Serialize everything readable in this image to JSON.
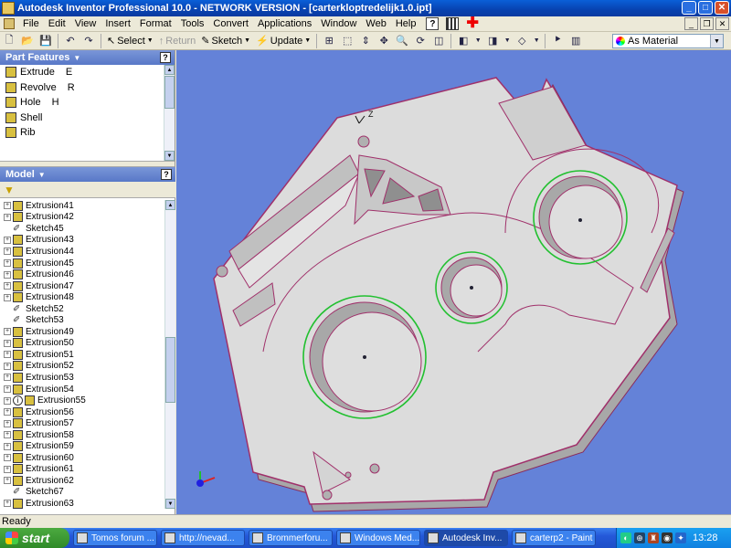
{
  "window": {
    "title": "Autodesk Inventor Professional 10.0 - NETWORK VERSION - [carterkloptredelijk1.0.ipt]",
    "controls": [
      "_",
      "□",
      "✕"
    ]
  },
  "menu": {
    "items": [
      "File",
      "Edit",
      "View",
      "Insert",
      "Format",
      "Tools",
      "Convert",
      "Applications",
      "Window",
      "Web",
      "Help"
    ],
    "mdi_controls": [
      "_",
      "❐",
      "✕"
    ]
  },
  "toolbar": {
    "select_label": "Select",
    "return_label": "Return",
    "sketch_label": "Sketch",
    "update_label": "Update",
    "material_value": "As Material"
  },
  "part_features": {
    "title": "Part Features",
    "help": "?",
    "items": [
      {
        "label": "Extrude",
        "key": "E"
      },
      {
        "label": "Revolve",
        "key": "R"
      },
      {
        "label": "Hole",
        "key": "H"
      },
      {
        "label": "Shell",
        "key": ""
      },
      {
        "label": "Rib",
        "key": ""
      }
    ]
  },
  "model": {
    "title": "Model",
    "help": "?",
    "tree": [
      {
        "label": "Extrusion41",
        "type": "extrusion"
      },
      {
        "label": "Extrusion42",
        "type": "extrusion"
      },
      {
        "label": "Sketch45",
        "type": "sketch"
      },
      {
        "label": "Extrusion43",
        "type": "extrusion"
      },
      {
        "label": "Extrusion44",
        "type": "extrusion"
      },
      {
        "label": "Extrusion45",
        "type": "extrusion"
      },
      {
        "label": "Extrusion46",
        "type": "extrusion"
      },
      {
        "label": "Extrusion47",
        "type": "extrusion"
      },
      {
        "label": "Extrusion48",
        "type": "extrusion"
      },
      {
        "label": "Sketch52",
        "type": "sketch"
      },
      {
        "label": "Sketch53",
        "type": "sketch"
      },
      {
        "label": "Extrusion49",
        "type": "extrusion"
      },
      {
        "label": "Extrusion50",
        "type": "extrusion"
      },
      {
        "label": "Extrusion51",
        "type": "extrusion"
      },
      {
        "label": "Extrusion52",
        "type": "extrusion"
      },
      {
        "label": "Extrusion53",
        "type": "extrusion"
      },
      {
        "label": "Extrusion54",
        "type": "extrusion"
      },
      {
        "label": "Extrusion55",
        "type": "info"
      },
      {
        "label": "Extrusion56",
        "type": "extrusion"
      },
      {
        "label": "Extrusion57",
        "type": "extrusion"
      },
      {
        "label": "Extrusion58",
        "type": "extrusion"
      },
      {
        "label": "Extrusion59",
        "type": "extrusion"
      },
      {
        "label": "Extrusion60",
        "type": "extrusion"
      },
      {
        "label": "Extrusion61",
        "type": "extrusion"
      },
      {
        "label": "Extrusion62",
        "type": "extrusion"
      },
      {
        "label": "Sketch67",
        "type": "sketch"
      },
      {
        "label": "Extrusion63",
        "type": "extrusion"
      }
    ]
  },
  "viewport": {
    "background": "#6482d8",
    "part_color": "#dcdcdc",
    "edge_color": "#a0306a",
    "highlight_color": "#22c030",
    "axis_label": "Z"
  },
  "status": {
    "text": "Ready"
  },
  "taskbar": {
    "start_label": "start",
    "tasks": [
      "Tomos forum ...",
      "http://nevad...",
      "Brommerforu...",
      "Windows Med...",
      "Autodesk Inv...",
      "carterp2 - Paint"
    ],
    "active_task": 4,
    "clock": "13:28"
  }
}
